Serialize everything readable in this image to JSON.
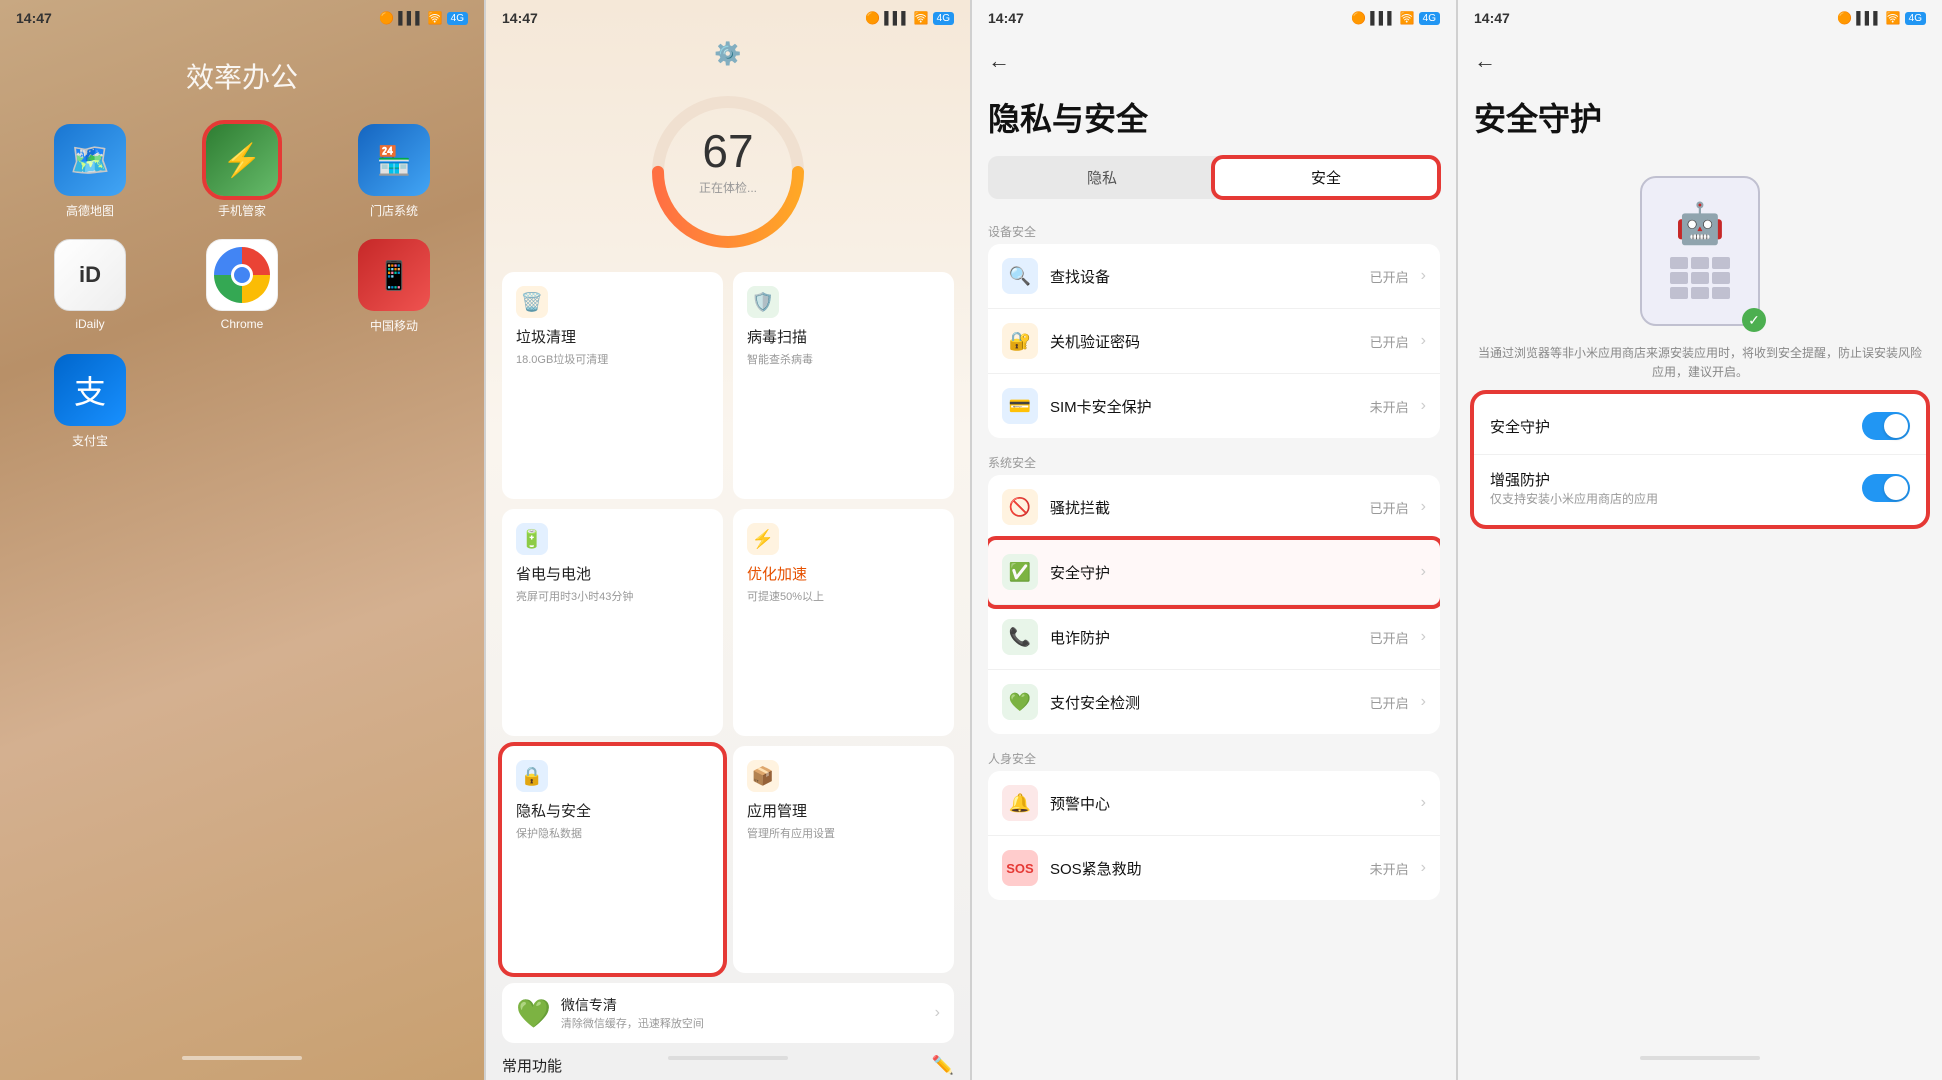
{
  "panel1": {
    "time": "14:47",
    "folder_title": "效率办公",
    "apps": [
      {
        "id": "gaode",
        "label": "高德地图",
        "icon": "📍",
        "bg": "icon-gaode",
        "highlighted": false
      },
      {
        "id": "phone-manager",
        "label": "手机管家",
        "icon": "⚡",
        "bg": "icon-phone-manager",
        "highlighted": true
      },
      {
        "id": "app-store",
        "label": "门店系统",
        "icon": "🏪",
        "bg": "icon-app-store",
        "highlighted": false
      },
      {
        "id": "idaily",
        "label": "iDaily",
        "icon": "📅",
        "bg": "icon-idaily",
        "highlighted": false
      },
      {
        "id": "chrome",
        "label": "Chrome",
        "icon": "chrome",
        "bg": "icon-chrome",
        "highlighted": false
      },
      {
        "id": "china-mobile",
        "label": "中国移动",
        "icon": "📱",
        "bg": "icon-china-mobile",
        "highlighted": false
      },
      {
        "id": "alipay",
        "label": "支付宝",
        "icon": "💳",
        "bg": "icon-alipay",
        "highlighted": false
      }
    ]
  },
  "panel2": {
    "time": "14:47",
    "score": "67",
    "score_label": "正在体检...",
    "menu_items": [
      {
        "id": "trash",
        "title": "垃圾清理",
        "subtitle": "18.0GB垃圾可清理",
        "icon": "🗑️",
        "icon_bg": "bg-orange",
        "highlighted": false
      },
      {
        "id": "virus",
        "title": "病毒扫描",
        "subtitle": "智能查杀病毒",
        "icon": "🛡️",
        "icon_bg": "bg-green",
        "highlighted": false
      },
      {
        "id": "battery",
        "title": "省电与电池",
        "subtitle": "亮屏可用时3小时43分钟",
        "icon": "🔋",
        "icon_bg": "bg-blue",
        "highlighted": false
      },
      {
        "id": "speed",
        "title": "优化加速",
        "subtitle": "可提速50%以上",
        "icon": "⚡",
        "icon_bg": "bg-orange",
        "highlighted": false
      },
      {
        "id": "privacy",
        "title": "隐私与安全",
        "subtitle": "保护隐私数据",
        "icon": "🔒",
        "icon_bg": "bg-blue",
        "highlighted": true
      },
      {
        "id": "app-mgmt",
        "title": "应用管理",
        "subtitle": "管理所有应用设置",
        "icon": "📦",
        "icon_bg": "bg-orange",
        "highlighted": false
      }
    ],
    "wechat_title": "微信专清",
    "wechat_subtitle": "清除微信缓存，迅速释放空间",
    "common_func": "常用功能"
  },
  "panel3": {
    "time": "14:47",
    "back_label": "←",
    "page_title": "隐私与安全",
    "tabs": [
      {
        "id": "privacy",
        "label": "隐私",
        "active": false
      },
      {
        "id": "security",
        "label": "安全",
        "active": true
      }
    ],
    "section_device": "设备安全",
    "device_items": [
      {
        "id": "find-device",
        "title": "查找设备",
        "status": "已开启",
        "icon": "🔍",
        "icon_bg": "bg-blue"
      },
      {
        "id": "power-password",
        "title": "关机验证密码",
        "status": "已开启",
        "icon": "🔐",
        "icon_bg": "bg-orange"
      },
      {
        "id": "sim-protect",
        "title": "SIM卡安全保护",
        "status": "未开启",
        "icon": "💳",
        "icon_bg": "bg-blue"
      }
    ],
    "section_system": "系统安全",
    "system_items": [
      {
        "id": "intercept",
        "title": "骚扰拦截",
        "status": "已开启",
        "icon": "🚫",
        "icon_bg": "bg-orange",
        "highlighted": false
      },
      {
        "id": "security-guard",
        "title": "安全守护",
        "status": "",
        "icon": "✅",
        "icon_bg": "bg-green",
        "highlighted": true
      },
      {
        "id": "anti-fraud",
        "title": "电诈防护",
        "status": "已开启",
        "icon": "📞",
        "icon_bg": "bg-green",
        "highlighted": false
      },
      {
        "id": "payment-check",
        "title": "支付安全检测",
        "status": "已开启",
        "icon": "💚",
        "icon_bg": "bg-green",
        "highlighted": false
      }
    ],
    "section_personal": "人身安全",
    "personal_items": [
      {
        "id": "alert-center",
        "title": "预警中心",
        "status": "",
        "icon": "🔔",
        "icon_bg": "bg-red"
      },
      {
        "id": "sos",
        "title": "SOS紧急救助",
        "status": "未开启",
        "icon": "🆘",
        "icon_bg": "bg-red"
      }
    ]
  },
  "panel4": {
    "time": "14:47",
    "back_label": "←",
    "page_title": "安全守护",
    "desc": "当通过浏览器等非小米应用商店来源安装应用时，将收到安全提醒，防止误安装风险应用，建议开启。",
    "toggles": [
      {
        "id": "security-guard",
        "title": "安全守护",
        "subtitle": "",
        "enabled": true
      },
      {
        "id": "enhanced-protection",
        "title": "增强防护",
        "subtitle": "仅支持安装小米应用商店的应用",
        "enabled": true
      }
    ]
  },
  "icons": {
    "signal": "▌▌▌",
    "wifi": "WiFi",
    "4g": "4G",
    "dot": "●"
  }
}
